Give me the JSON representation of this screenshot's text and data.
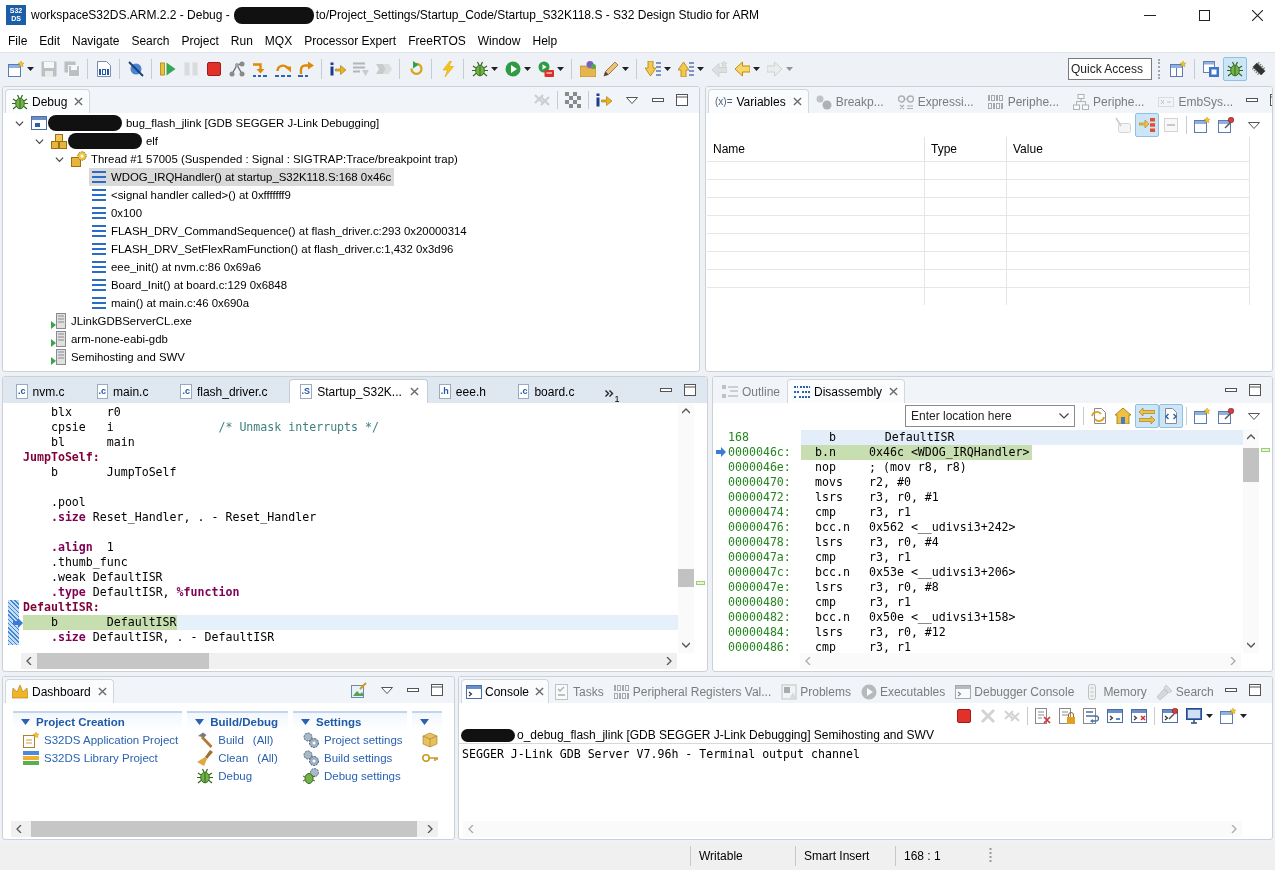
{
  "window": {
    "logo": [
      "S32",
      "DS"
    ],
    "title": "workspaceS32DS.ARM.2.2 - Debug -",
    "title_redacted": true,
    "title_rest": "to/Project_Settings/Startup_Code/Startup_S32K118.S - S32 Design Studio for ARM"
  },
  "menu": [
    "File",
    "Edit",
    "Navigate",
    "Search",
    "Project",
    "Run",
    "MQX",
    "Processor Expert",
    "FreeRTOS",
    "Window",
    "Help"
  ],
  "toolbar": {
    "groups": [
      [
        {
          "kind": "new_wizard",
          "disabled": false,
          "menu": true
        },
        {
          "kind": "save",
          "disabled": true
        },
        {
          "kind": "save_all",
          "disabled": true
        }
      ],
      [
        {
          "kind": "binary",
          "disabled": false
        }
      ],
      [
        {
          "kind": "skip_breakpoints",
          "disabled": false
        }
      ],
      [
        {
          "kind": "resume",
          "disabled": false
        },
        {
          "kind": "suspend",
          "disabled": true
        },
        {
          "kind": "terminate",
          "disabled": false
        },
        {
          "kind": "disconnect",
          "disabled": false
        },
        {
          "kind": "step_into",
          "disabled": false
        },
        {
          "kind": "step_over",
          "disabled": false
        },
        {
          "kind": "step_return",
          "disabled": false
        }
      ],
      [
        {
          "kind": "instruction_step",
          "disabled": false
        },
        {
          "kind": "drop_frame",
          "disabled": true
        },
        {
          "kind": "step_filters",
          "disabled": true
        }
      ],
      [
        {
          "kind": "restart",
          "disabled": false
        }
      ],
      [
        {
          "kind": "lightning",
          "disabled": false
        }
      ],
      [
        {
          "kind": "debug",
          "disabled": false,
          "menu": true
        },
        {
          "kind": "run",
          "disabled": false,
          "menu": true
        },
        {
          "kind": "external_tools",
          "disabled": false,
          "menu": true
        }
      ],
      [
        {
          "kind": "open_folder",
          "disabled": false
        },
        {
          "kind": "pen",
          "disabled": false,
          "menu": true
        }
      ],
      [
        {
          "kind": "next_annotation",
          "disabled": false,
          "menu": true
        },
        {
          "kind": "prev_annotation",
          "disabled": false,
          "menu": true
        },
        {
          "kind": "last_edit",
          "disabled": true
        },
        {
          "kind": "back",
          "disabled": false,
          "menu": true
        },
        {
          "kind": "forward",
          "disabled": true,
          "menu": true
        }
      ]
    ],
    "quick_access": {
      "placeholder": "Quick Access"
    },
    "perspectives": [
      {
        "kind": "open_perspective",
        "selected": false
      },
      {
        "kind": "c_cpp",
        "selected": false
      },
      {
        "kind": "debug",
        "selected": true
      },
      {
        "kind": "chip",
        "selected": false
      }
    ]
  },
  "debug_view": {
    "tabs": [
      {
        "label": "Debug",
        "kind": "debug",
        "selected": true
      }
    ],
    "tools": [
      [
        {
          "kind": "remove_all",
          "disabled": true,
          "on": false
        }
      ],
      [
        {
          "kind": "grid",
          "disabled": false,
          "on": false
        }
      ],
      [
        {
          "kind": "instruction_step",
          "disabled": false,
          "on": false
        }
      ]
    ],
    "tree": [
      {
        "label": "bug_flash_jlink [GDB SEGGER J-Link Debugging]",
        "kind": "launch",
        "redacted": true,
        "expanded": true,
        "selected": false,
        "children": [
          {
            "label": "elf",
            "kind": "target",
            "redacted": true,
            "expanded": true,
            "selected": false,
            "children": [
              {
                "label": "Thread #1 57005 (Suspended : Signal : SIGTRAP:Trace/breakpoint trap)",
                "kind": "thread",
                "expanded": true,
                "selected": false,
                "children": [
                  {
                    "label": "WDOG_IRQHandler() at startup_S32K118.S:168 0x46c",
                    "kind": "frame",
                    "selected": true
                  },
                  {
                    "label": "<signal handler called>() at 0xfffffff9",
                    "kind": "frame",
                    "selected": false
                  },
                  {
                    "label": "0x100",
                    "kind": "frame",
                    "selected": false
                  },
                  {
                    "label": "FLASH_DRV_CommandSequence() at flash_driver.c:293 0x20000314",
                    "kind": "frame",
                    "selected": false
                  },
                  {
                    "label": "FLASH_DRV_SetFlexRamFunction() at flash_driver.c:1,432 0x3d96",
                    "kind": "frame",
                    "selected": false
                  },
                  {
                    "label": "eee_init() at nvm.c:86 0x69a6",
                    "kind": "frame",
                    "selected": false
                  },
                  {
                    "label": "Board_Init() at board.c:129 0x6848",
                    "kind": "frame",
                    "selected": false
                  },
                  {
                    "label": "main() at main.c:46 0x690a",
                    "kind": "frame",
                    "selected": false
                  }
                ]
              }
            ]
          },
          {
            "label": "JLinkGDBServerCL.exe",
            "kind": "process",
            "selected": false
          },
          {
            "label": "arm-none-eabi-gdb",
            "kind": "process",
            "selected": false
          },
          {
            "label": "Semihosting and SWV",
            "kind": "process",
            "selected": false
          }
        ]
      }
    ]
  },
  "variables_view": {
    "tabs": [
      {
        "label": "Variables",
        "icon_text": "(x)=",
        "selected": true
      },
      {
        "label": "Breakp...",
        "kind": "breakpoints",
        "selected": false
      },
      {
        "label": "Expressi...",
        "kind": "expressions",
        "selected": false
      },
      {
        "label": "Periphe...",
        "kind": "binary_digits",
        "selected": false
      },
      {
        "label": "Periphe...",
        "kind": "tree_nodes",
        "selected": false
      },
      {
        "label": "EmbSys...",
        "kind": "registers",
        "selected": false
      }
    ],
    "tools": [
      [
        {
          "kind": "show_type_names",
          "disabled": true,
          "on": false
        },
        {
          "kind": "layout",
          "disabled": false,
          "on": true
        },
        {
          "kind": "collapse_all",
          "disabled": true,
          "on": false
        }
      ],
      [
        {
          "kind": "new_view",
          "disabled": false,
          "on": false
        },
        {
          "kind": "pin",
          "disabled": false,
          "on": false
        }
      ]
    ],
    "columns": [
      "Name",
      "Type",
      "Value"
    ]
  },
  "editor": {
    "tabs": [
      {
        "label": "nvm.c",
        "icon_text": ".c",
        "selected": false
      },
      {
        "label": "main.c",
        "icon_text": ".c",
        "selected": false
      },
      {
        "label": "flash_driver.c",
        "icon_text": ".c",
        "selected": false
      },
      {
        "label": "Startup_S32K...",
        "icon_text": ".S",
        "selected": true
      },
      {
        "label": "eee.h",
        "icon_text": ".h",
        "selected": false
      },
      {
        "label": "board.c",
        "icon_text": ".c",
        "selected": false
      }
    ],
    "overflow": "1",
    "lines": [
      {
        "segments": [
          {
            "text": "    blx     r0",
            "kind": "plain"
          }
        ],
        "current": false,
        "in_range": false
      },
      {
        "segments": [
          {
            "text": "    cpsie   i               ",
            "kind": "plain"
          },
          {
            "text": "/* Unmask interrupts */",
            "kind": "comment"
          }
        ],
        "current": false,
        "in_range": false
      },
      {
        "segments": [
          {
            "text": "    bl      main",
            "kind": "plain"
          }
        ],
        "current": false,
        "in_range": false
      },
      {
        "segments": [
          {
            "text": "JumpToSelf:",
            "kind": "label"
          }
        ],
        "current": false,
        "in_range": false
      },
      {
        "segments": [
          {
            "text": "    b       JumpToSelf",
            "kind": "plain"
          }
        ],
        "current": false,
        "in_range": false
      },
      {
        "current": false,
        "in_range": false
      },
      {
        "segments": [
          {
            "text": "    .pool",
            "kind": "plain"
          }
        ],
        "current": false,
        "in_range": false
      },
      {
        "segments": [
          {
            "text": "    .size",
            "kind": "directive"
          },
          {
            "text": " Reset_Handler, . - Reset_Handler",
            "kind": "plain"
          }
        ],
        "current": false,
        "in_range": false
      },
      {
        "current": false,
        "in_range": false
      },
      {
        "segments": [
          {
            "text": "    .align",
            "kind": "directive"
          },
          {
            "text": "  1",
            "kind": "plain"
          }
        ],
        "current": false,
        "in_range": false
      },
      {
        "segments": [
          {
            "text": "    .thumb_func",
            "kind": "plain"
          }
        ],
        "current": false,
        "in_range": false
      },
      {
        "segments": [
          {
            "text": "    .weak DefaultISR",
            "kind": "plain"
          }
        ],
        "current": false,
        "in_range": false
      },
      {
        "segments": [
          {
            "text": "    .type",
            "kind": "directive"
          },
          {
            "text": " DefaultISR, ",
            "kind": "plain"
          },
          {
            "text": "%function",
            "kind": "directive"
          }
        ],
        "current": false,
        "in_range": false
      },
      {
        "segments": [
          {
            "text": "DefaultISR:",
            "kind": "label"
          }
        ],
        "current": false,
        "in_range": true
      },
      {
        "segments": [
          {
            "text": "    b       DefaultISR",
            "kind": "plain"
          }
        ],
        "current": true,
        "in_range": true
      },
      {
        "segments": [
          {
            "text": "    .size",
            "kind": "directive"
          },
          {
            "text": " DefaultISR, . - DefaultISR",
            "kind": "plain"
          }
        ],
        "current": false,
        "in_range": true
      }
    ]
  },
  "disassembly_view": {
    "tabs": [
      {
        "label": "Outline",
        "kind": "outline",
        "selected": false
      },
      {
        "label": "Disassembly",
        "kind": "disassembly",
        "selected": true
      }
    ],
    "location": {
      "placeholder": "Enter location here"
    },
    "tools": [
      [
        {
          "kind": "refresh",
          "disabled": false,
          "on": false
        },
        {
          "kind": "home",
          "disabled": false,
          "on": false
        },
        {
          "kind": "link",
          "disabled": false,
          "on": true
        },
        {
          "kind": "sync",
          "disabled": false,
          "on": true
        }
      ],
      [
        {
          "kind": "new_view",
          "disabled": false,
          "on": false
        },
        {
          "kind": "pin",
          "disabled": false,
          "on": false
        }
      ]
    ],
    "rows": [
      {
        "kind": "source",
        "line": "168",
        "text": "    b       DefaultISR"
      },
      {
        "kind": "instruction",
        "address": "0000046c:",
        "mnemonic": "b.n",
        "operands": "0x46c <WDOG_IRQHandler>",
        "current": true
      },
      {
        "kind": "instruction",
        "address": "0000046e:",
        "mnemonic": "nop",
        "operands": "; (mov r8, r8)",
        "current": false
      },
      {
        "kind": "instruction",
        "address": "00000470:",
        "mnemonic": "movs",
        "operands": "r2, #0",
        "current": false
      },
      {
        "kind": "instruction",
        "address": "00000472:",
        "mnemonic": "lsrs",
        "operands": "r3, r0, #1",
        "current": false
      },
      {
        "kind": "instruction",
        "address": "00000474:",
        "mnemonic": "cmp",
        "operands": "r3, r1",
        "current": false
      },
      {
        "kind": "instruction",
        "address": "00000476:",
        "mnemonic": "bcc.n",
        "operands": "0x562 <__udivsi3+242>",
        "current": false
      },
      {
        "kind": "instruction",
        "address": "00000478:",
        "mnemonic": "lsrs",
        "operands": "r3, r0, #4",
        "current": false
      },
      {
        "kind": "instruction",
        "address": "0000047a:",
        "mnemonic": "cmp",
        "operands": "r3, r1",
        "current": false
      },
      {
        "kind": "instruction",
        "address": "0000047c:",
        "mnemonic": "bcc.n",
        "operands": "0x53e <__udivsi3+206>",
        "current": false
      },
      {
        "kind": "instruction",
        "address": "0000047e:",
        "mnemonic": "lsrs",
        "operands": "r3, r0, #8",
        "current": false
      },
      {
        "kind": "instruction",
        "address": "00000480:",
        "mnemonic": "cmp",
        "operands": "r3, r1",
        "current": false
      },
      {
        "kind": "instruction",
        "address": "00000482:",
        "mnemonic": "bcc.n",
        "operands": "0x50e <__udivsi3+158>",
        "current": false
      },
      {
        "kind": "instruction",
        "address": "00000484:",
        "mnemonic": "lsrs",
        "operands": "r3, r0, #12",
        "current": false
      },
      {
        "kind": "instruction",
        "address": "00000486:",
        "mnemonic": "cmp",
        "operands": "r3, r1",
        "current": false
      }
    ]
  },
  "dashboard": {
    "tabs": [
      {
        "label": "Dashboard",
        "kind": "dashboard",
        "selected": true
      }
    ],
    "tools": [
      [
        {
          "kind": "edit_image",
          "disabled": false,
          "on": false
        }
      ]
    ],
    "sections": [
      {
        "title": "Project Creation",
        "expanded": true,
        "items": [
          {
            "label": "S32DS Application Project",
            "kind": "app_project"
          },
          {
            "label": "S32DS Library Project",
            "kind": "lib_project"
          }
        ]
      },
      {
        "title": "Build/Debug",
        "expanded": true,
        "items": [
          {
            "label": "Build",
            "scope": "(All)",
            "kind": "build"
          },
          {
            "label": "Clean",
            "scope": "(All)",
            "kind": "clean"
          },
          {
            "label": "Debug",
            "kind": "debug"
          }
        ]
      },
      {
        "title": "Settings",
        "expanded": true,
        "items": [
          {
            "label": "Project settings",
            "kind": "settings"
          },
          {
            "label": "Build settings",
            "kind": "settings"
          },
          {
            "label": "Debug settings",
            "kind": "debug_settings"
          }
        ]
      },
      {
        "expanded": true,
        "items": [
          {
            "kind": "package"
          },
          {
            "kind": "key"
          }
        ]
      }
    ]
  },
  "console": {
    "tabs": [
      {
        "label": "Console",
        "kind": "console",
        "selected": true
      },
      {
        "label": "Tasks",
        "kind": "tasks",
        "selected": false
      },
      {
        "label": "Peripheral Registers Val...",
        "kind": "binary_digits",
        "selected": false
      },
      {
        "label": "Problems",
        "kind": "problems",
        "selected": false
      },
      {
        "label": "Executables",
        "kind": "executables",
        "selected": false
      },
      {
        "label": "Debugger Console",
        "kind": "console",
        "selected": false
      },
      {
        "label": "Memory",
        "kind": "memory",
        "selected": false
      },
      {
        "label": "Search",
        "kind": "search",
        "selected": false
      }
    ],
    "tools": [
      [
        {
          "kind": "terminate",
          "disabled": false,
          "on": false
        },
        {
          "kind": "remove",
          "disabled": true,
          "on": false
        },
        {
          "kind": "remove_all",
          "disabled": true,
          "on": false
        }
      ],
      [
        {
          "kind": "clear",
          "disabled": false,
          "on": false
        },
        {
          "kind": "scroll_lock",
          "disabled": false,
          "on": false
        },
        {
          "kind": "word_wrap",
          "disabled": false,
          "on": false
        },
        {
          "kind": "show_stdout",
          "disabled": false,
          "on": false
        },
        {
          "kind": "show_stderr",
          "disabled": false,
          "on": false
        }
      ],
      [
        {
          "kind": "pin_console",
          "disabled": false,
          "on": false
        },
        {
          "kind": "display",
          "disabled": false,
          "on": false,
          "menu": true
        },
        {
          "kind": "new_view",
          "disabled": false,
          "on": false,
          "menu": true
        }
      ]
    ],
    "process_redacted": true,
    "process_label": "o_debug_flash_jlink [GDB SEGGER J-Link Debugging] Semihosting and SWV",
    "output": [
      "SEGGER J-Link GDB Server V7.96h - Terminal output channel"
    ]
  },
  "status_bar": {
    "fields": [
      "Writable",
      "Smart Insert",
      "168 : 1"
    ]
  }
}
